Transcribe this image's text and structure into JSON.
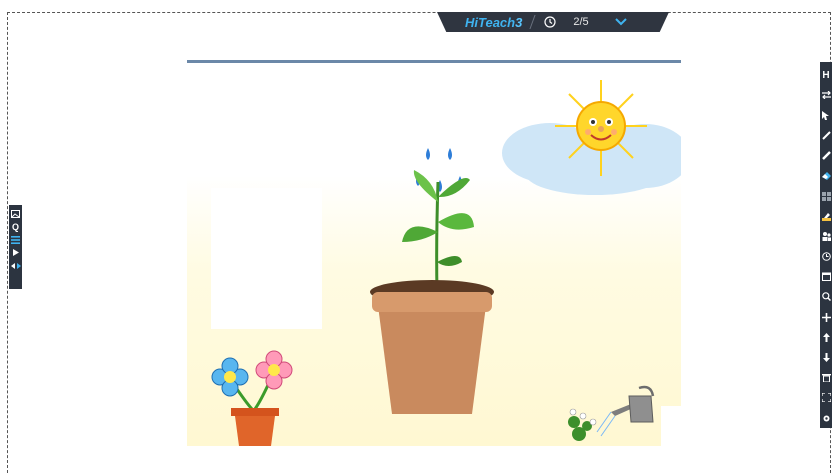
{
  "topbar": {
    "brand": "HiTeach",
    "brand_version": "3",
    "pages": "2/5",
    "timer_icon": "clock-icon",
    "menu_icon": "chevron-down-icon"
  },
  "left_toolbar": {
    "items": [
      {
        "icon": "image-icon"
      },
      {
        "icon": "search-icon",
        "label": "Q"
      },
      {
        "icon": "list-icon"
      },
      {
        "icon": "play-icon"
      },
      {
        "icon": "prev-next-icon"
      }
    ]
  },
  "right_toolbar": {
    "items": [
      {
        "icon": "home-icon",
        "label": "H"
      },
      {
        "icon": "swap-icon"
      },
      {
        "icon": "cursor-icon"
      },
      {
        "icon": "pen-icon"
      },
      {
        "icon": "brush-icon"
      },
      {
        "icon": "eraser-icon"
      },
      {
        "icon": "grid-icon"
      },
      {
        "icon": "highlighter-icon"
      },
      {
        "icon": "students-icon"
      },
      {
        "icon": "timer-icon"
      },
      {
        "icon": "calendar-icon"
      },
      {
        "icon": "magnifier-icon"
      },
      {
        "icon": "add-icon"
      },
      {
        "icon": "upload-icon"
      },
      {
        "icon": "download-icon"
      },
      {
        "icon": "trash-icon"
      },
      {
        "icon": "fullscreen-icon"
      },
      {
        "icon": "settings-icon"
      }
    ]
  },
  "slide": {
    "page": 2,
    "total_pages": 5
  },
  "colors": {
    "toolbar_bg": "#2c3440",
    "brand_blue": "#3fb3f0",
    "slide_line": "#6b88a8"
  }
}
